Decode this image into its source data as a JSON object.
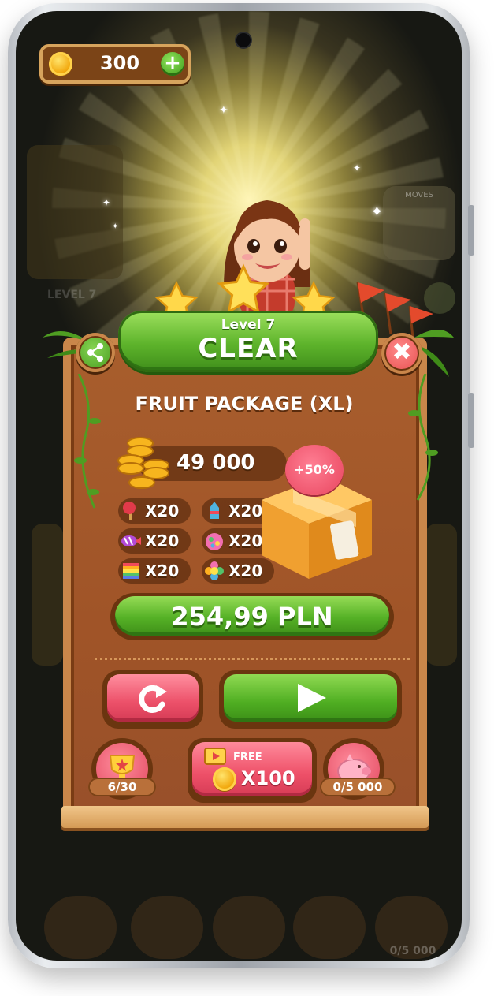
{
  "top_bar": {
    "coins": "300",
    "plus_symbol": "+"
  },
  "background": {
    "moves_label": "MOVES",
    "level_label": "LEVEL 7",
    "bottom_progress": "0/5 000"
  },
  "dialog": {
    "level_label": "Level 7",
    "status_title": "CLEAR",
    "close_symbol": "✖",
    "package_title": "FRUIT PACKAGE (XL)",
    "coin_amount": "49 000",
    "discount_badge": "+50%",
    "items": [
      {
        "icon": "hammer-icon",
        "quantity": "X20"
      },
      {
        "icon": "rocket-icon",
        "quantity": "X20"
      },
      {
        "icon": "striped-candy-icon",
        "quantity": "X20"
      },
      {
        "icon": "color-bomb-icon",
        "quantity": "X20"
      },
      {
        "icon": "rainbow-icon",
        "quantity": "X20"
      },
      {
        "icon": "flower-icon",
        "quantity": "X20"
      }
    ],
    "price": "254,99 PLN",
    "free_label": "FREE",
    "free_amount": "X100",
    "trophy_progress": "6/30",
    "piggy_progress": "0/5 000"
  },
  "colors": {
    "accent_green": "#55b126",
    "accent_pink": "#ec5069",
    "board_brown": "#a05428"
  }
}
